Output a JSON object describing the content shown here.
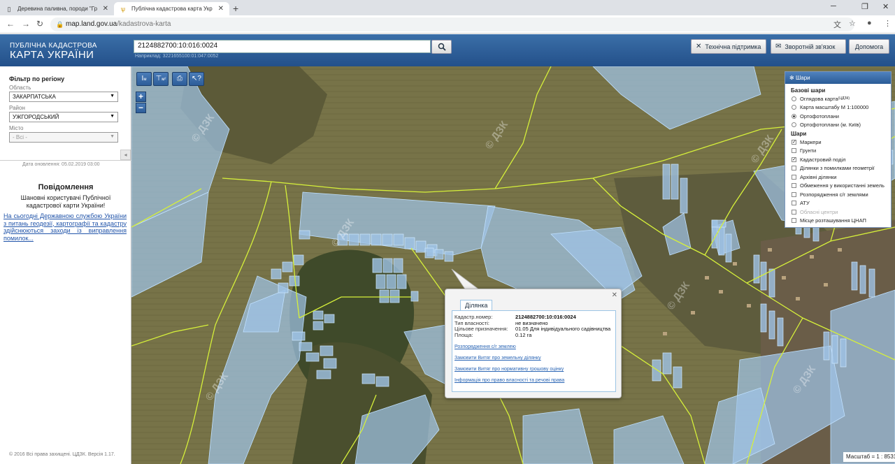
{
  "browser": {
    "tabs": [
      {
        "title": "Деревина паливна, породи \"Гр",
        "active": false
      },
      {
        "title": "Публічна кадастрова карта Укр",
        "active": true
      }
    ],
    "url_host": "map.land.gov.ua",
    "url_path": "/kadastrova-karta"
  },
  "header": {
    "brand_line1": "ПУБЛІЧНА КАДАСТРОВА",
    "brand_line2": "КАРТА УКРАЇНИ",
    "search_value": "2124882700:10:016:0024",
    "search_hint": "Наприклад: 3221655100:01:047:0052",
    "support_label": "Технічна підтримка",
    "feedback_label": "Зворотній зв'язок",
    "help_label": "Допомога"
  },
  "sidebar": {
    "filter_title": "Фільтр по регіону",
    "oblast_label": "Область",
    "oblast_value": "ЗАКАРПАТСЬКА",
    "raion_label": "Район",
    "raion_value": "УЖГОРОДСЬКИЙ",
    "city_label": "Місто",
    "city_value": "- Всі -",
    "updated": "Дата оновлення: 05.02.2019 03:00",
    "msg_title": "Повідомлення",
    "msg_text": "Шановні користувачі Публічної кадастрової карти України!",
    "msg_link": "На сьогодні Державною службою України з питань геодезії, картографії та кадастру здійснюються заходи із виправлення помилок...",
    "copyright": "© 2016 Всі права захищені. ЦДЗК. Версія 1.17."
  },
  "map": {
    "watermark": "© ДЗК",
    "layers": {
      "title": "Шари",
      "base_title": "Базові шари",
      "base": [
        {
          "label": "Оглядова карта",
          "sup": "(ЦДЗК)",
          "selected": false
        },
        {
          "label": "Карта масштабу М 1:100000",
          "selected": false
        },
        {
          "label": "Ортофотоплани",
          "selected": true
        },
        {
          "label": "Ортофотоплани (м. Київ)",
          "selected": false
        }
      ],
      "overlay_title": "Шари",
      "overlays": [
        {
          "label": "Маркери",
          "checked": true
        },
        {
          "label": "Грунти",
          "checked": false
        },
        {
          "label": "Кадастровий поділ",
          "checked": true
        },
        {
          "label": "Ділянки з помилками геометрії",
          "checked": false
        },
        {
          "label": "Архівні ділянки",
          "checked": false
        },
        {
          "label": "Обмеження у використанні земель",
          "checked": false
        },
        {
          "label": "Розпорядження с/г землями",
          "checked": false
        },
        {
          "label": "АТУ",
          "checked": false
        },
        {
          "label": "Обласні центри",
          "checked": false,
          "disabled": true
        },
        {
          "label": "Місце розташування ЦНАП",
          "checked": false
        }
      ]
    },
    "popup": {
      "tab": "Ділянка",
      "rows": [
        {
          "k": "Кадастр.номер:",
          "v": "2124882700:10:016:0024"
        },
        {
          "k": "Тип власності:",
          "v": "не визначено"
        },
        {
          "k": "Цільове призначення:",
          "v": "01.05 Для індивідуального садівництва"
        },
        {
          "k": "Площа:",
          "v": "0.12 га"
        }
      ],
      "links": [
        "Розпорядження с/г землею",
        "Замовити Витяг про земельну ділянку",
        "Замовити Витяг про нормативну грошову оцінку",
        "Інформація про право власності та речові права"
      ]
    },
    "scale": "Масштаб = 1 : 8531",
    "colors": {
      "parcel": "#9fc3e6",
      "boundary": "#d6f03a"
    }
  }
}
